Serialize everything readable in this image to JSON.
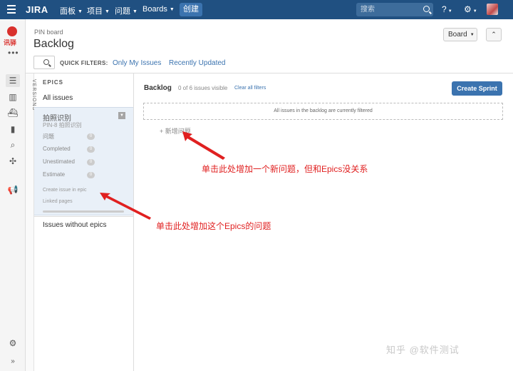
{
  "topnav": {
    "logo": "JIRA",
    "menu": [
      "面板",
      "项目",
      "问题",
      "Boards"
    ],
    "create_label": "创建",
    "search_placeholder": "搜索",
    "help_icon": "?",
    "settings_icon": "⚙"
  },
  "sidebar": {
    "project_label": "讯驿",
    "more": "•••"
  },
  "header": {
    "breadcrumb": "PIN board",
    "title": "Backlog",
    "board_button": "Board",
    "collapse_icon": "⌃"
  },
  "filters": {
    "label": "QUICK FILTERS:",
    "items": [
      "Only My Issues",
      "Recently Updated"
    ]
  },
  "versions_tab": "VERSIONS",
  "epics": {
    "header": "EPICS",
    "all_issues": "All issues",
    "card": {
      "name": "拍照识别",
      "key": "PIN-8 拍照识别",
      "stats": [
        {
          "label": "问题",
          "count": "0"
        },
        {
          "label": "Completed",
          "count": "0"
        },
        {
          "label": "Unestimated",
          "count": "0"
        },
        {
          "label": "Estimate",
          "count": "0"
        }
      ],
      "create_link": "Create issue in epic",
      "linked_pages": "Linked pages"
    },
    "without": "Issues without epics"
  },
  "backlog": {
    "title": "Backlog",
    "count": "0 of 6 issues visible",
    "clear": "Clear all filters",
    "create_sprint": "Create Sprint",
    "filtered_msg": "All issues in the backlog are currently filtered",
    "add_issue": "+ 新增问题"
  },
  "annotations": {
    "new_issue": "单击此处增加一个新问题，但和Epics没关系",
    "epic_issue": "单击此处增加这个Epics的问题"
  },
  "watermark": "知乎 @软件测试",
  "colors": {
    "nav": "#205081",
    "accent": "#3b73af",
    "annotation": "#e02020"
  }
}
